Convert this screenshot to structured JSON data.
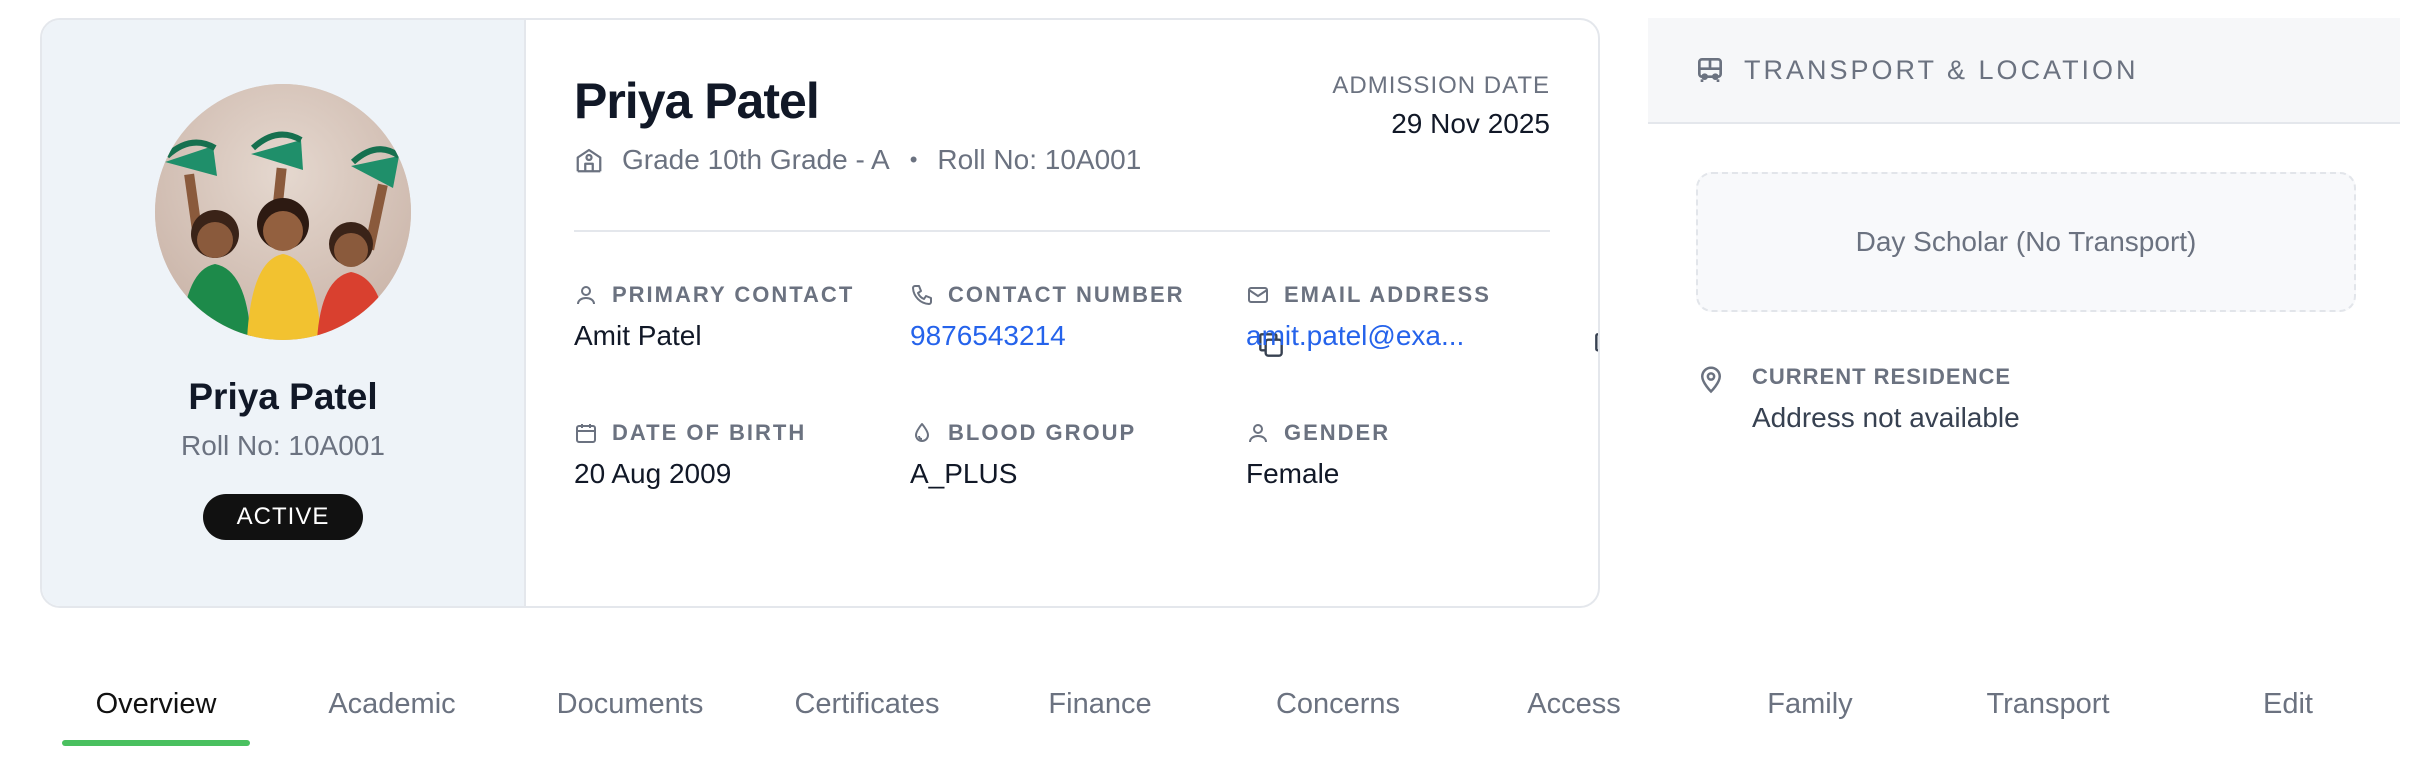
{
  "profile": {
    "name": "Priya Patel",
    "roll": "Roll No: 10A001",
    "status": "ACTIVE",
    "grade": "Grade 10th Grade - A",
    "grade_separator": "•",
    "roll_inline": "Roll No: 10A001",
    "admission_label": "ADMISSION DATE",
    "admission_date": "29 Nov 2025"
  },
  "fields": {
    "primary_contact": {
      "label": "PRIMARY CONTACT",
      "value": "Amit Patel",
      "icon": "user-icon"
    },
    "contact_number": {
      "label": "CONTACT NUMBER",
      "value": "9876543214",
      "icon": "phone-icon"
    },
    "email": {
      "label": "EMAIL ADDRESS",
      "value": "amit.patel@exa...",
      "icon": "mail-icon"
    },
    "dob": {
      "label": "DATE OF BIRTH",
      "value": "20 Aug 2009",
      "icon": "calendar-icon"
    },
    "blood_group": {
      "label": "BLOOD GROUP",
      "value": "A_PLUS",
      "icon": "droplet-icon"
    },
    "gender": {
      "label": "GENDER",
      "value": "Female",
      "icon": "user-icon"
    }
  },
  "transport": {
    "title": "TRANSPORT & LOCATION",
    "status": "Day Scholar (No Transport)",
    "residence_label": "CURRENT RESIDENCE",
    "residence_value": "Address not available"
  },
  "tabs": [
    {
      "label": "Overview",
      "active": true
    },
    {
      "label": "Academic"
    },
    {
      "label": "Documents"
    },
    {
      "label": "Certificates"
    },
    {
      "label": "Finance"
    },
    {
      "label": "Concerns"
    },
    {
      "label": "Access"
    },
    {
      "label": "Family"
    },
    {
      "label": "Transport"
    },
    {
      "label": "Edit"
    }
  ],
  "colors": {
    "link": "#2563eb",
    "active_tab_underline": "#4ac05f",
    "badge_bg": "#111111",
    "left_panel_bg": "#eef3f8"
  }
}
